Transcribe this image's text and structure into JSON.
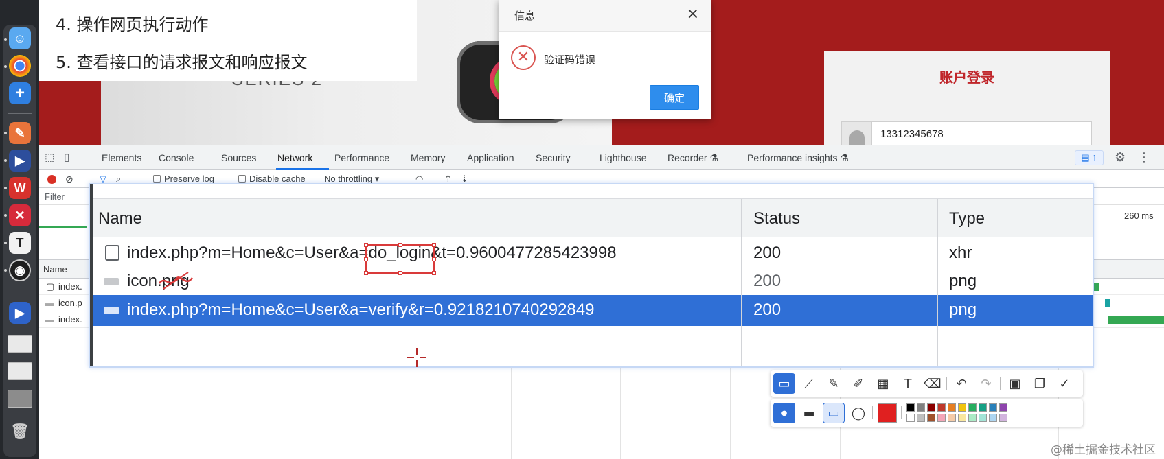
{
  "background_page": {
    "steps": [
      {
        "num": "4.",
        "text": "操作网页执行动作"
      },
      {
        "num": "5.",
        "text": "查看接口的请求报文和响应报文"
      }
    ],
    "login_title": "账户登录",
    "login_phone_value": "13312345678"
  },
  "dialog": {
    "title": "信息",
    "close_icon": "×",
    "message": "验证码错误",
    "ok_label": "确定"
  },
  "devtools": {
    "tabs": [
      "Elements",
      "Console",
      "Sources",
      "Network",
      "Performance",
      "Memory",
      "Application",
      "Security",
      "Lighthouse",
      "Recorder",
      "Performance insights"
    ],
    "active_tab": "Network",
    "issues_count": "1",
    "toolbar": {
      "preserve_log": "Preserve log",
      "disable_cache": "Disable cache",
      "throttling": "No throttling"
    },
    "filter_label": "Filter",
    "overview_time": "260 ms",
    "list_header_name": "Name",
    "mini_rows": [
      "index.",
      "icon.p",
      "index."
    ]
  },
  "zoom_table": {
    "headers": {
      "name": "Name",
      "status": "Status",
      "type": "Type"
    },
    "rows": [
      {
        "name_pre": "index.php?m=Home&c=User&a=",
        "name_highlight": "do_login",
        "name_post": "&t=0.9600477285423998",
        "status": "200",
        "type": "xhr",
        "icon": "document-icon",
        "selected": false
      },
      {
        "name_pre": "icon.",
        "name_highlight": "png",
        "name_post": "",
        "status": "200",
        "type": "png",
        "icon": "image-icon",
        "selected": false
      },
      {
        "name_pre": "index.php?m=Home&c=User&a=verify&r=0.9218210740292849",
        "name_highlight": "",
        "name_post": "",
        "status": "200",
        "type": "png",
        "icon": "image-icon",
        "selected": true
      }
    ]
  },
  "watermark": "@稀土掘金技术社区",
  "colors": {
    "accent_blue": "#1a73e8",
    "selected_row": "#2f6fd6",
    "page_red": "#a41c1c",
    "error_red": "#d9534f",
    "annotation_red": "#d93a3a"
  },
  "annotation_palette": {
    "current_color": "#e02020",
    "swatches": [
      "#000000",
      "#808080",
      "#8b0000",
      "#c0392b",
      "#e67e22",
      "#f1c40f",
      "#27ae60",
      "#16a085",
      "#2980b9",
      "#8e44ad",
      "#ffffff",
      "#c0c0c0",
      "#a0522d",
      "#f4a6b7",
      "#f5cba7",
      "#f9e79f",
      "#abebc6",
      "#a3e4d7",
      "#aed6f1",
      "#d2b4de"
    ]
  }
}
